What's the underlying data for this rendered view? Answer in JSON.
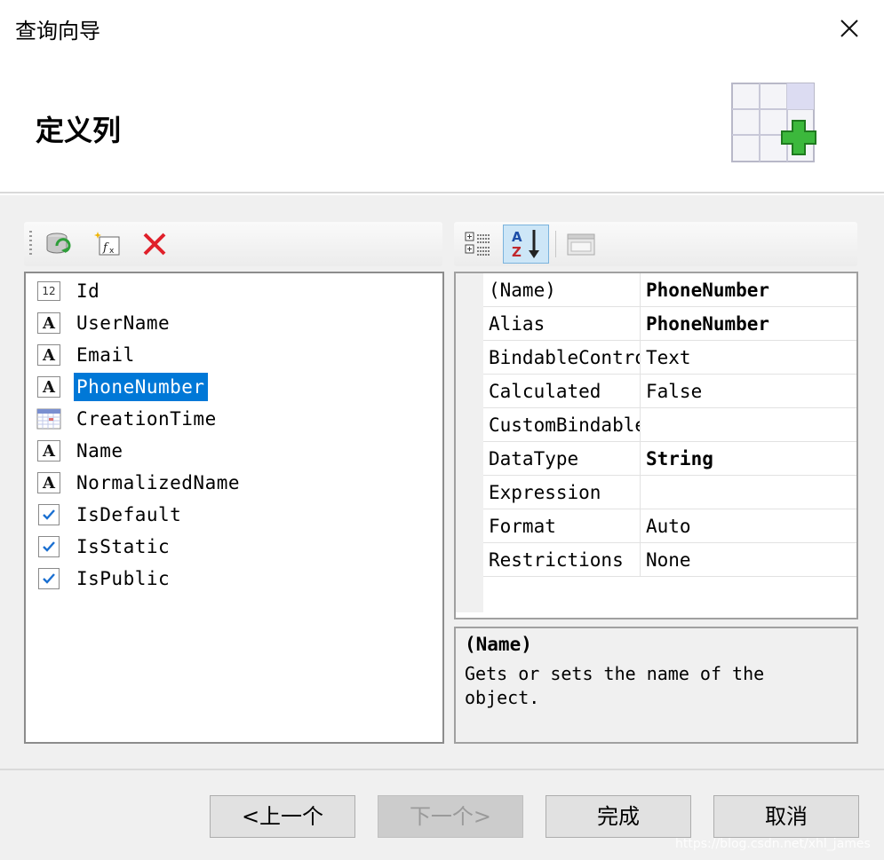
{
  "window": {
    "title": "查询向导"
  },
  "header": {
    "title": "定义列"
  },
  "icons": {
    "refresh": "database-refresh-icon",
    "function": "add-function-icon",
    "delete": "delete-icon",
    "categorized": "categorized-view-icon",
    "alphabetical": "alphabetical-sort-icon",
    "property_pages": "property-pages-icon",
    "wizard": "table-add-icon"
  },
  "columns": [
    {
      "label": "Id",
      "type": "number",
      "selected": false
    },
    {
      "label": "UserName",
      "type": "text",
      "selected": false
    },
    {
      "label": "Email",
      "type": "text",
      "selected": false
    },
    {
      "label": "PhoneNumber",
      "type": "text",
      "selected": true
    },
    {
      "label": "CreationTime",
      "type": "datetime",
      "selected": false
    },
    {
      "label": "Name",
      "type": "text",
      "selected": false
    },
    {
      "label": "NormalizedName",
      "type": "text",
      "selected": false
    },
    {
      "label": "IsDefault",
      "type": "bool",
      "selected": false
    },
    {
      "label": "IsStatic",
      "type": "bool",
      "selected": false
    },
    {
      "label": "IsPublic",
      "type": "bool",
      "selected": false
    }
  ],
  "properties": [
    {
      "name": "(Name)",
      "value": "PhoneNumber",
      "bold": true
    },
    {
      "name": "Alias",
      "value": "PhoneNumber",
      "bold": true
    },
    {
      "name": "BindableControl",
      "value": "Text",
      "bold": false
    },
    {
      "name": "Calculated",
      "value": "False",
      "bold": false
    },
    {
      "name": "CustomBindableControl",
      "value": "",
      "bold": false
    },
    {
      "name": "DataType",
      "value": "String",
      "bold": true
    },
    {
      "name": "Expression",
      "value": "",
      "bold": false
    },
    {
      "name": "Format",
      "value": "Auto",
      "bold": false
    },
    {
      "name": "Restrictions",
      "value": "None",
      "bold": false
    }
  ],
  "description": {
    "title": "(Name)",
    "text": "Gets or sets the name of the object."
  },
  "buttons": {
    "prev": "<上一个",
    "next": "下一个>",
    "finish": "完成",
    "cancel": "取消"
  },
  "watermark": "https://blog.csdn.net/xhl_james",
  "colors": {
    "selection": "#0078d7",
    "delete": "#e0202a",
    "plus": "#3cb83c"
  }
}
